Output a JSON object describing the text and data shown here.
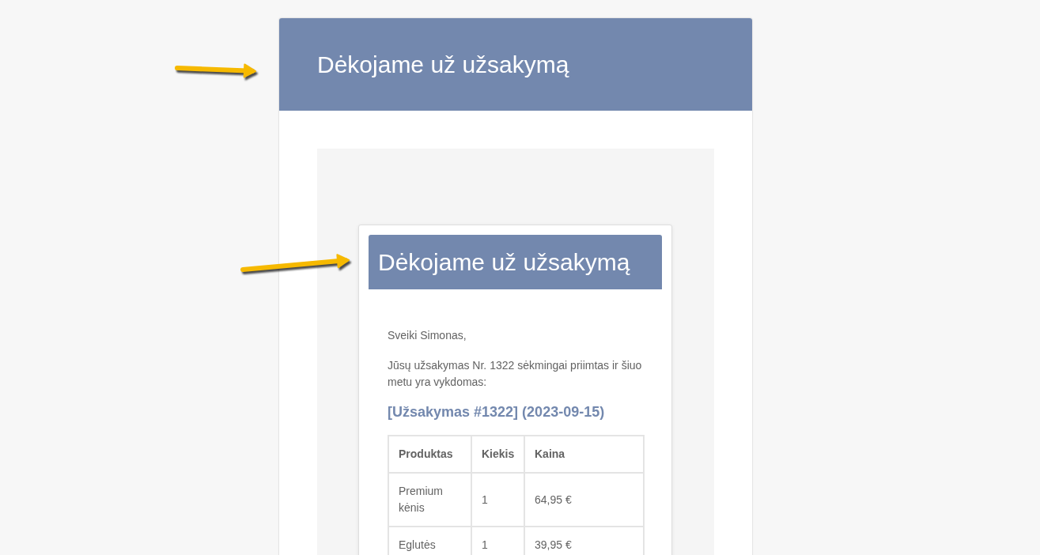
{
  "page_header": {
    "title": "Dėkojame už užsakymą"
  },
  "email": {
    "header": {
      "title": "Dėkojame už užsakymą"
    },
    "greeting": "Sveiki Simonas,",
    "intro": "Jūsų užsakymas Nr. 1322 sėkmingai priimtas ir šiuo metu yra vykdomas:",
    "order_heading": "[Užsakymas #1322] (2023-09-15)",
    "table": {
      "columns": [
        "Produktas",
        "Kiekis",
        "Kaina"
      ],
      "rows": [
        [
          "Premium kėnis",
          "1",
          "64,95 €"
        ],
        [
          "Eglutės",
          "1",
          "39,95 €"
        ]
      ]
    }
  }
}
